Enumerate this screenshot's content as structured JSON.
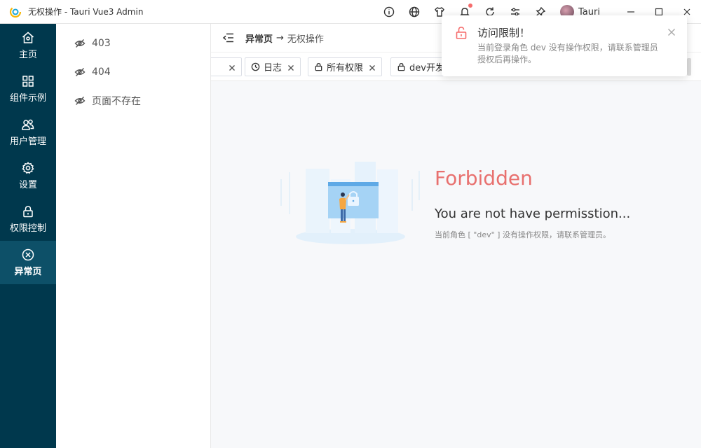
{
  "window": {
    "title": "无权操作 - Tauri Vue3 Admin",
    "user": "Tauri",
    "icons": [
      "info-icon",
      "globe-icon",
      "shirt-icon",
      "bell-icon",
      "refresh-icon",
      "sliders-icon",
      "pin-icon"
    ]
  },
  "sidebar": {
    "items": [
      {
        "label": "主页",
        "icon": "home-icon"
      },
      {
        "label": "组件示例",
        "icon": "grid-icon"
      },
      {
        "label": "用户管理",
        "icon": "users-icon"
      },
      {
        "label": "设置",
        "icon": "gear-icon"
      },
      {
        "label": "权限控制",
        "icon": "lock-icon"
      },
      {
        "label": "异常页",
        "icon": "error-circle-icon",
        "active": true
      }
    ]
  },
  "submenu": {
    "items": [
      {
        "label": "403",
        "icon": "eye-off-icon"
      },
      {
        "label": "404",
        "icon": "eye-off-icon"
      },
      {
        "label": "页面不存在",
        "icon": "eye-off-icon"
      }
    ]
  },
  "breadcrumb": {
    "parent": "异常页",
    "separator": "→",
    "current": "无权操作"
  },
  "tabs": [
    {
      "label": "",
      "icon": ""
    },
    {
      "label": "日志",
      "icon": "clock-icon"
    },
    {
      "label": "所有权限",
      "icon": "lock-icon"
    },
    {
      "label": "dev开发",
      "icon": "lock-icon"
    }
  ],
  "error": {
    "title": "Forbidden",
    "subtitle": "You are not have permisstion...",
    "description": "当前角色 [ \"dev\" ] 没有操作权限，请联系管理员。"
  },
  "notification": {
    "title": "访问限制！",
    "message": "当前登录角色 dev 没有操作权限，请联系管理员授权后再操作。",
    "icon": "unlock-icon"
  },
  "colors": {
    "sidebar": "#00384d",
    "sidebar_active": "#0d5068",
    "error_red": "#e8706e",
    "notify_icon": "#f56c6c"
  }
}
